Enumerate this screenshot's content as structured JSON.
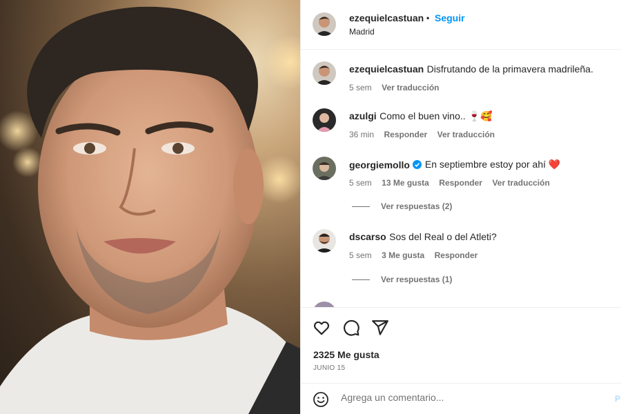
{
  "post": {
    "author": "ezequielcastuan",
    "separator": "•",
    "follow_label": "Seguir",
    "location": "Madrid",
    "caption_author": "ezequielcastuan",
    "caption_text": "Disfrutando de la primavera madrileña.",
    "caption_time": "5 sem",
    "caption_translate": "Ver traducción"
  },
  "comments": [
    {
      "user": "azulgi",
      "text": "Como el buen vino.. 🍷🥰",
      "time": "36 min",
      "reply_label": "Responder",
      "translate_label": "Ver traducción"
    },
    {
      "user": "georgiemollo",
      "verified": true,
      "text": "En septiembre estoy por ahí ❤️",
      "time": "5 sem",
      "likes": "13 Me gusta",
      "reply_label": "Responder",
      "translate_label": "Ver traducción",
      "view_replies": "Ver respuestas (2)"
    },
    {
      "user": "dscarso",
      "text": "Sos del Real o del Atleti?",
      "time": "5 sem",
      "likes": "3 Me gusta",
      "reply_label": "Responder",
      "view_replies": "Ver respuestas (1)"
    }
  ],
  "actions": {
    "like_icon": "heart-icon",
    "comment_icon": "comment-icon",
    "share_icon": "share-icon",
    "likes_count": "2325 Me gusta",
    "date": "JUNIO 15"
  },
  "add_comment": {
    "emoji_icon": "emoji-icon",
    "placeholder": "Agrega un comentario...",
    "publish_label": "P"
  },
  "colors": {
    "follow": "#0095f6",
    "verified": "#0095f6",
    "heart": "#ed1c24",
    "muted": "#737373"
  }
}
